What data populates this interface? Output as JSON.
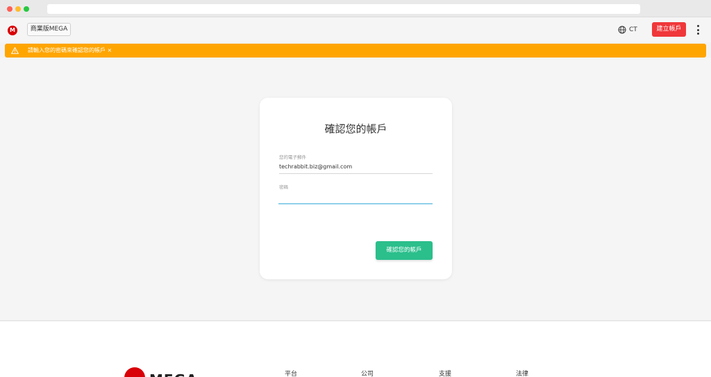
{
  "brand": {
    "logo_letter": "M",
    "color": "#d90007"
  },
  "topbar": {
    "business_label": "商業版MEGA",
    "language_code": "CT",
    "create_account_label": "建立帳戶",
    "create_account_color": "#f0373a"
  },
  "banner": {
    "text": "請輸入您的密碼來確認您的帳戶",
    "close": "×",
    "color": "#ffa500"
  },
  "card": {
    "title": "確認您的帳戶",
    "email_label": "您的電子郵件",
    "email_value": "techrabbit.biz@gmail.com",
    "password_label": "密碼",
    "password_value": "",
    "confirm_label": "確認您的帳戶",
    "confirm_color": "#2bbf8c"
  },
  "footer": {
    "wordmark": "MEGA",
    "columns": [
      "平台",
      "公司",
      "支援",
      "法律"
    ]
  },
  "icons": {
    "logo": "mega-logo-icon",
    "language": "globe-icon",
    "menu": "more-vertical-icon",
    "warning": "warning-triangle-icon"
  }
}
